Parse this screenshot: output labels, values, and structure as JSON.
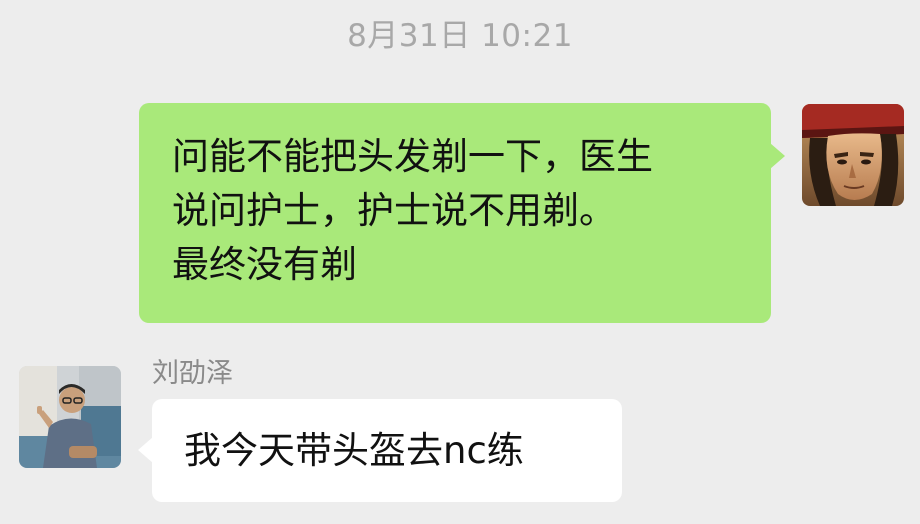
{
  "chat": {
    "timestamp": "8月31日 10:21",
    "messages": [
      {
        "direction": "outgoing",
        "lines": [
          "问能不能把头发剃一下，医生",
          "说问护士，护士说不用剃。",
          "最终没有剃"
        ],
        "bubble_color": "#a9e97a"
      },
      {
        "direction": "incoming",
        "sender": "刘劭泽",
        "text": "我今天带头盔去nc练",
        "bubble_color": "#ffffff"
      }
    ]
  },
  "icons": {
    "self_avatar": "cartoon-pirate-avatar",
    "contact_avatar": "person-photo-avatar"
  },
  "theme": {
    "background": "#ededed",
    "timestamp_color": "#a8a8a8",
    "sender_name_color": "#8a8a8a"
  }
}
